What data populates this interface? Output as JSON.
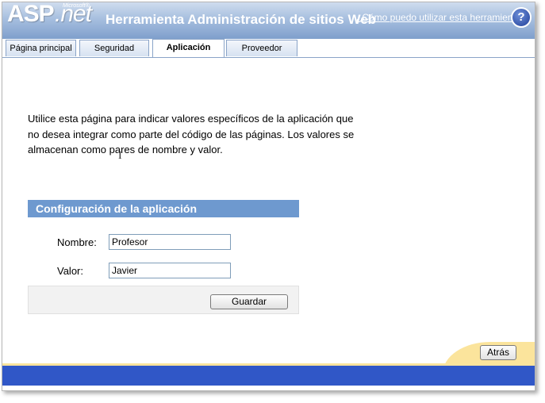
{
  "logo": {
    "asp": "ASP",
    "net": ".net",
    "microsoft": "Microsoft®"
  },
  "header": {
    "title": "Herramienta Administración de sitios Web",
    "help_link": "¿Cómo puedo utilizar esta herramienta?",
    "help_icon": "?"
  },
  "tabs": [
    {
      "label": "Página principal"
    },
    {
      "label": "Seguridad"
    },
    {
      "label": "Aplicación",
      "active": true
    },
    {
      "label": "Proveedor"
    }
  ],
  "intro_text": "Utilice esta página para indicar valores específicos de la aplicación que no desea integrar como parte del código de las páginas. Los valores se almacenan como pares de nombre y valor.",
  "panel": {
    "title": "Configuración de la aplicación",
    "name_label": "Nombre:",
    "name_value": "Profesor",
    "value_label": "Valor:",
    "value_value": "Javier",
    "save_label": "Guardar"
  },
  "footer": {
    "back_label": "Atrás"
  },
  "colors": {
    "header_gradient_top": "#cfdcee",
    "header_gradient_bottom": "#7f9fcc",
    "panel_header": "#6e99cf",
    "footer_bar": "#3057c7",
    "footer_accent": "#fbe49c"
  }
}
